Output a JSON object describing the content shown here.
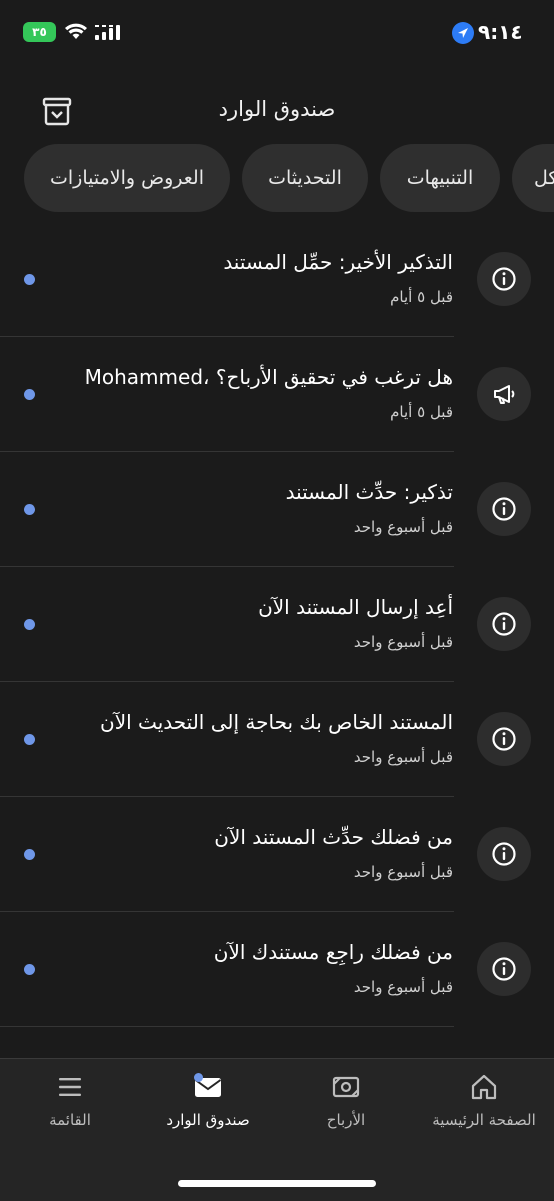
{
  "status_bar": {
    "time": "٩:١٤",
    "battery": "٣٥",
    "icons": [
      "battery-charging-icon",
      "wifi-icon",
      "signal-icon",
      "location-arrow-icon"
    ]
  },
  "header": {
    "title": "صندوق الوارد",
    "archive_icon": "archive-icon"
  },
  "tabs": [
    {
      "label": "العروض والامتيازات"
    },
    {
      "label": "التحديثات"
    },
    {
      "label": "التنبيهات"
    },
    {
      "label": "الكل"
    }
  ],
  "notifications": [
    {
      "title": "التذكير الأخير: حمِّل المستند",
      "time": "قبل ٥ أيام",
      "icon": "info-icon",
      "unread": true
    },
    {
      "title": "هل ترغب في تحقيق الأرباح؟ ،Mohammed",
      "time": "قبل ٥ أيام",
      "icon": "megaphone-icon",
      "unread": true
    },
    {
      "title": "تذكير: حدِّث المستند",
      "time": "قبل أسبوع واحد",
      "icon": "info-icon",
      "unread": true
    },
    {
      "title": "أعِد إرسال المستند الآن",
      "time": "قبل أسبوع واحد",
      "icon": "info-icon",
      "unread": true
    },
    {
      "title": "المستند الخاص بك بحاجة إلى التحديث الآن",
      "time": "قبل أسبوع واحد",
      "icon": "info-icon",
      "unread": true
    },
    {
      "title": "من فضلك حدِّث المستند الآن",
      "time": "قبل أسبوع واحد",
      "icon": "info-icon",
      "unread": true
    },
    {
      "title": "من فضلك راجِع مستندك الآن",
      "time": "قبل أسبوع واحد",
      "icon": "info-icon",
      "unread": true
    }
  ],
  "bottom_nav": [
    {
      "label": "القائمة",
      "icon": "menu-icon",
      "active": false
    },
    {
      "label": "صندوق الوارد",
      "icon": "inbox-envelope-icon",
      "active": true
    },
    {
      "label": "الأرباح",
      "icon": "earnings-icon",
      "active": false
    },
    {
      "label": "الصفحة الرئيسية",
      "icon": "home-icon",
      "active": false
    }
  ],
  "colors": {
    "background": "#1b1b1b",
    "surface": "#2f2f2f",
    "unread_dot": "#6f97e8",
    "battery": "#34c759",
    "location": "#2d7cf6"
  }
}
